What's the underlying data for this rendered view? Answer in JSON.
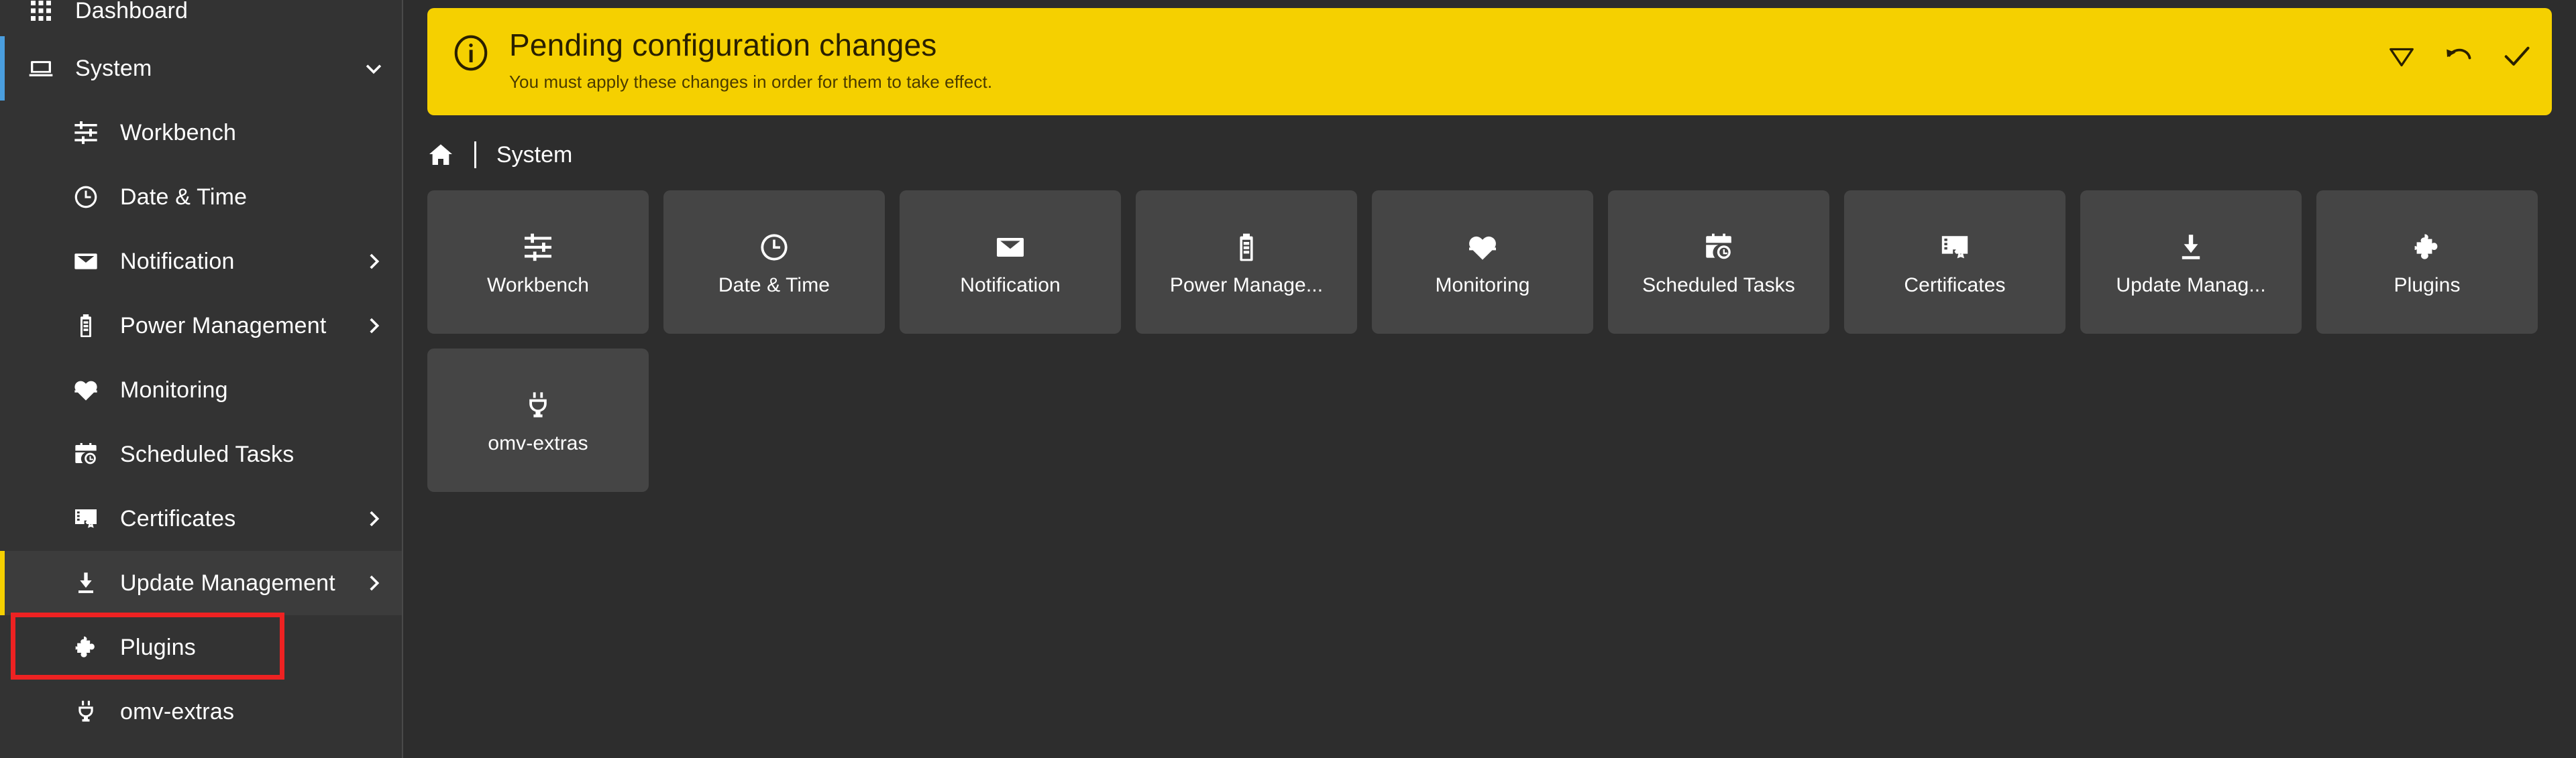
{
  "colors": {
    "accent_yellow": "#f5d000",
    "accent_blue": "#4a9ede",
    "highlight_red": "#ee2222",
    "sidebar_bg": "#333333",
    "main_bg": "#2d2d2d",
    "tile_bg": "#454545"
  },
  "sidebar": {
    "items": [
      {
        "label": "Dashboard",
        "icon": "grid-icon",
        "level": 0,
        "state": "normal",
        "chevron": "none"
      },
      {
        "label": "System",
        "icon": "laptop-icon",
        "level": 0,
        "state": "selected-blue",
        "chevron": "down"
      },
      {
        "label": "Workbench",
        "icon": "sliders-icon",
        "level": 1,
        "state": "normal",
        "chevron": "none"
      },
      {
        "label": "Date & Time",
        "icon": "clock-icon",
        "level": 1,
        "state": "normal",
        "chevron": "none"
      },
      {
        "label": "Notification",
        "icon": "envelope-icon",
        "level": 1,
        "state": "normal",
        "chevron": "right"
      },
      {
        "label": "Power Management",
        "icon": "battery-icon",
        "level": 1,
        "state": "normal",
        "chevron": "right"
      },
      {
        "label": "Monitoring",
        "icon": "heart-pulse-icon",
        "level": 1,
        "state": "normal",
        "chevron": "none"
      },
      {
        "label": "Scheduled Tasks",
        "icon": "calendar-clock-icon",
        "level": 1,
        "state": "normal",
        "chevron": "none"
      },
      {
        "label": "Certificates",
        "icon": "certificate-icon",
        "level": 1,
        "state": "normal",
        "chevron": "right"
      },
      {
        "label": "Update Management",
        "icon": "download-icon",
        "level": 1,
        "state": "selected-yellow",
        "chevron": "right"
      },
      {
        "label": "Plugins",
        "icon": "puzzle-piece-icon",
        "level": 1,
        "state": "highlighted",
        "chevron": "none"
      },
      {
        "label": "omv-extras",
        "icon": "power-plug-icon",
        "level": 1,
        "state": "normal",
        "chevron": "none"
      }
    ]
  },
  "banner": {
    "icon": "info-circle-icon",
    "title": "Pending configuration changes",
    "subtitle": "You must apply these changes in order for them to take effect.",
    "actions": [
      {
        "name": "show-details-button",
        "icon": "triangle-down-icon"
      },
      {
        "name": "revert-button",
        "icon": "undo-arrow-icon"
      },
      {
        "name": "apply-button",
        "icon": "check-icon"
      }
    ]
  },
  "breadcrumb": {
    "home_icon": "home-icon",
    "separator": "|",
    "current": "System"
  },
  "tiles": [
    {
      "label": "Workbench",
      "icon": "sliders-icon",
      "highlighted": false
    },
    {
      "label": "Date & Time",
      "icon": "clock-icon",
      "highlighted": false
    },
    {
      "label": "Notification",
      "icon": "envelope-icon",
      "highlighted": false
    },
    {
      "label": "Power Manage...",
      "icon": "battery-icon",
      "highlighted": false
    },
    {
      "label": "Monitoring",
      "icon": "heart-pulse-icon",
      "highlighted": false
    },
    {
      "label": "Scheduled Tasks",
      "icon": "calendar-clock-icon",
      "highlighted": false
    },
    {
      "label": "Certificates",
      "icon": "certificate-icon",
      "highlighted": false
    },
    {
      "label": "Update Manag...",
      "icon": "download-icon",
      "highlighted": false
    },
    {
      "label": "Plugins",
      "icon": "puzzle-piece-icon",
      "highlighted": true
    },
    {
      "label": "omv-extras",
      "icon": "power-plug-icon",
      "highlighted": false
    }
  ]
}
